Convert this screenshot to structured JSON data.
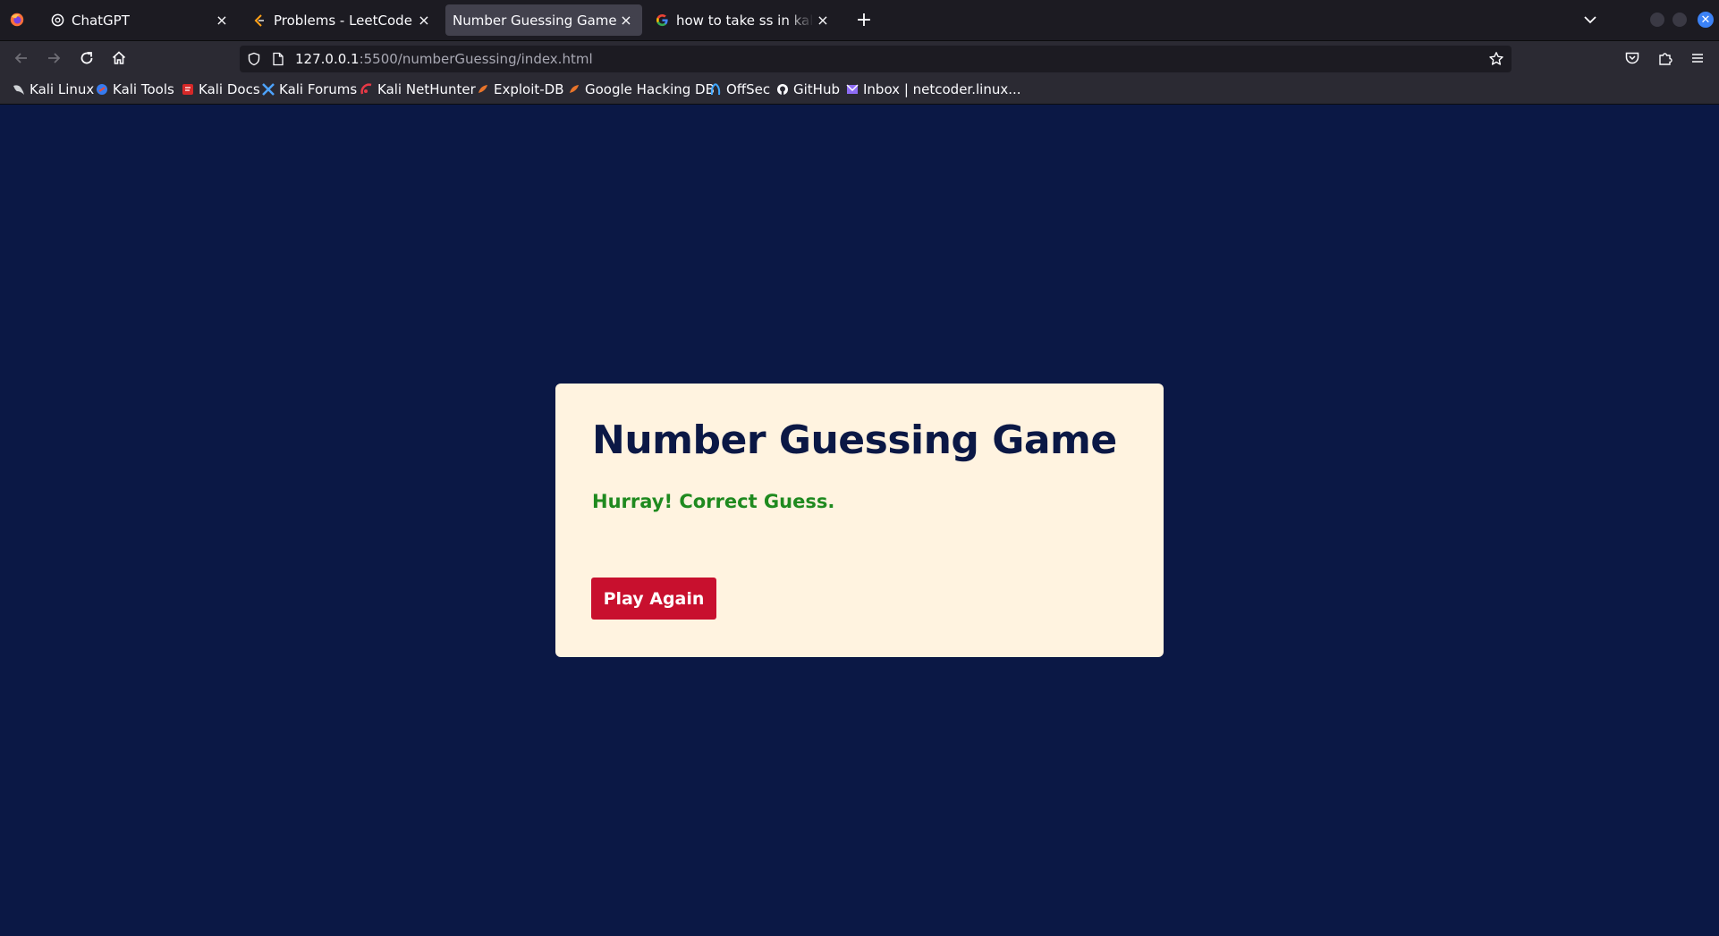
{
  "browser": {
    "tabs": [
      {
        "title": "ChatGPT",
        "icon": "chatgpt-icon",
        "close": "×"
      },
      {
        "title": "Problems - LeetCode",
        "icon": "leetcode-icon",
        "close": "×"
      },
      {
        "title": "Number Guessing Game",
        "icon": "none",
        "close": "×",
        "selected": true
      },
      {
        "title": "how to take ss in kali linux",
        "icon": "google-icon",
        "close": "×"
      }
    ],
    "new_tab": "+",
    "url": {
      "host": "127.0.0.1",
      "path": ":5500/numberGuessing/index.html"
    },
    "bookmarks": [
      {
        "label": "Kali Linux",
        "icon": "kali-dragon-icon"
      },
      {
        "label": "Kali Tools",
        "icon": "kali-tools-icon"
      },
      {
        "label": "Kali Docs",
        "icon": "kali-docs-icon"
      },
      {
        "label": "Kali Forums",
        "icon": "kali-forums-icon"
      },
      {
        "label": "Kali NetHunter",
        "icon": "nethunter-icon"
      },
      {
        "label": "Exploit-DB",
        "icon": "exploit-db-icon"
      },
      {
        "label": "Google Hacking DB",
        "icon": "ghdb-icon"
      },
      {
        "label": "OffSec",
        "icon": "offsec-icon"
      },
      {
        "label": "GitHub",
        "icon": "github-icon"
      },
      {
        "label": "Inbox | netcoder.linux...",
        "icon": "mail-icon"
      }
    ]
  },
  "page": {
    "title": "Number Guessing Game",
    "message": "Hurray! Correct Guess.",
    "play_again_label": "Play Again"
  },
  "colors": {
    "background": "#0b1845",
    "card": "#fff3e0",
    "message": "#1f8a1f",
    "button": "#c8102e"
  }
}
